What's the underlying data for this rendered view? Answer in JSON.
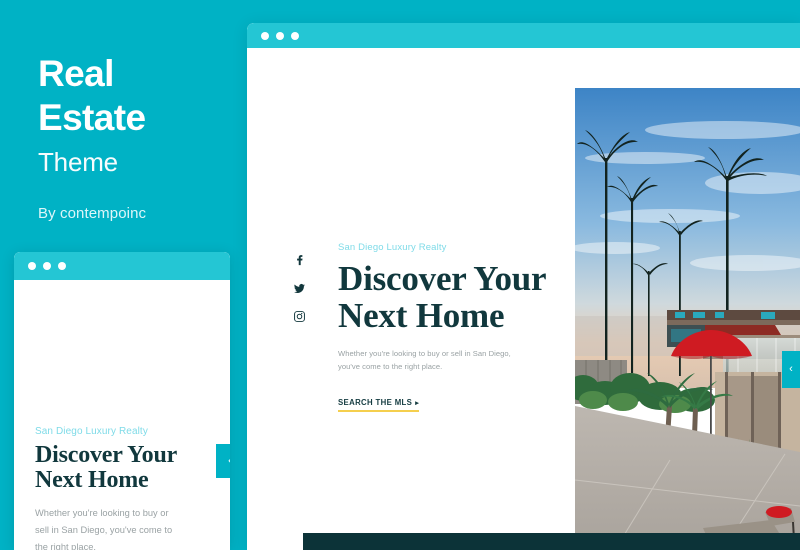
{
  "promo": {
    "title_line1": "Real",
    "title_line2": "Estate",
    "subtitle": "Theme",
    "byline": "By contempoinc"
  },
  "colors": {
    "background_teal": "#00b2c5",
    "titlebar_teal": "#24c6d4",
    "eyebrow_cyan": "#7fdbe8",
    "headline_dark": "#11383d",
    "cta_underline_gold": "#f5cf4e",
    "footer_bar_dark": "#0c3338",
    "body_text_gray": "#9aa2a4"
  },
  "main_window": {
    "titlebar": {
      "dots": [
        "window-dot",
        "window-dot",
        "window-dot"
      ]
    },
    "hero": {
      "eyebrow": "San Diego Luxury Realty",
      "headline_line1": "Discover Your",
      "headline_line2": "Next Home",
      "blurb_line1": "Whether you're looking to buy or sell in San Diego,",
      "blurb_line2": "you've come to the right place.",
      "cta_label": "SEARCH THE MLS",
      "cta_arrow": "▸"
    },
    "social": [
      {
        "name": "facebook-icon",
        "label": "Facebook"
      },
      {
        "name": "twitter-icon",
        "label": "Twitter"
      },
      {
        "name": "instagram-icon",
        "label": "Instagram"
      }
    ],
    "slider_prev_label": "‹",
    "photo_alt": "Beachfront luxury home patio with palm trees, red umbrella and lounge chairs at dusk"
  },
  "preview_window": {
    "titlebar": {
      "dots": [
        "window-dot",
        "window-dot",
        "window-dot"
      ]
    },
    "hero": {
      "eyebrow": "San Diego Luxury Realty",
      "headline_line1": "Discover Your",
      "headline_line2": "Next Home",
      "blurb_line1": "Whether you're looking to buy or",
      "blurb_line2": "sell in San Diego, you've come to",
      "blurb_line3": "the right place."
    },
    "slider_prev_label": "‹"
  }
}
